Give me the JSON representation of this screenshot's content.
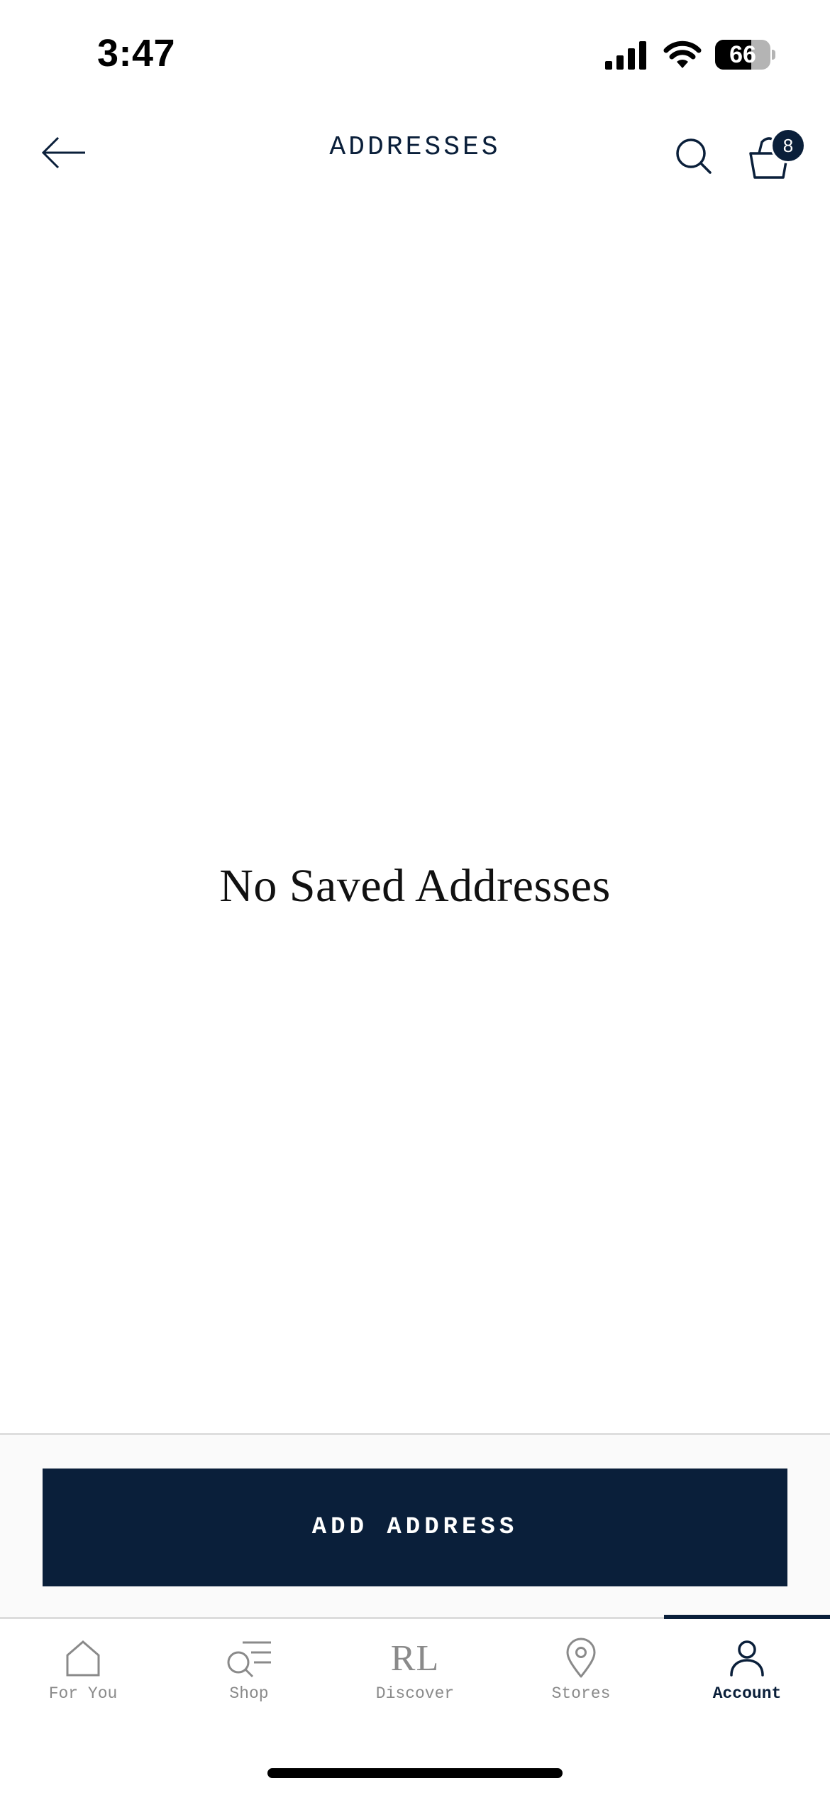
{
  "status_bar": {
    "time": "3:47",
    "battery_percent": 66,
    "battery_label": "66"
  },
  "header": {
    "title": "ADDRESSES",
    "bag_count": "8"
  },
  "empty_state": {
    "message": "No Saved Addresses"
  },
  "actions": {
    "add_address_label": "ADD ADDRESS"
  },
  "tab_bar": {
    "active_tab": "Account",
    "items": [
      {
        "label": "For You",
        "icon": "home-icon"
      },
      {
        "label": "Shop",
        "icon": "shop-search-icon"
      },
      {
        "label": "Discover",
        "icon": "rl-logo-icon",
        "mark": "RL"
      },
      {
        "label": "Stores",
        "icon": "location-pin-icon"
      },
      {
        "label": "Account",
        "icon": "person-icon"
      }
    ]
  },
  "colors": {
    "brand_navy": "#0a1f3a",
    "inactive_gray": "#8a8a8a"
  }
}
